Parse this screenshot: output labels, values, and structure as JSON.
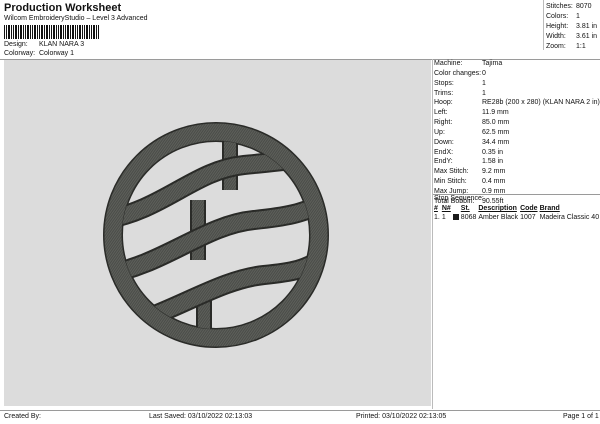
{
  "header": {
    "title": "Production Worksheet",
    "subtitle": "Wilcom EmbroideryStudio – Level 3 Advanced"
  },
  "info": {
    "design_label": "Design:",
    "design_value": "KLAN NARA 3",
    "colorway_label": "Colorway:",
    "colorway_value": "Colorway 1"
  },
  "top_stats": [
    {
      "k": "Stitches:",
      "v": "8070"
    },
    {
      "k": "Colors:",
      "v": "1"
    },
    {
      "k": "Height:",
      "v": "3.81 in"
    },
    {
      "k": "Width:",
      "v": "3.61 in"
    },
    {
      "k": "Zoom:",
      "v": "1:1"
    }
  ],
  "details": [
    {
      "k": "Machine:",
      "v": "Tajima"
    },
    {
      "k": "Color changes:",
      "v": "0"
    },
    {
      "k": "Stops:",
      "v": "1"
    },
    {
      "k": "Trims:",
      "v": "1"
    },
    {
      "k": "Hoop:",
      "v": "RE28b (200 x 280) (KLAN NARA 2 in)"
    },
    {
      "k": "Left:",
      "v": "11.9 mm"
    },
    {
      "k": "Right:",
      "v": "85.0 mm"
    },
    {
      "k": "Up:",
      "v": "62.5 mm"
    },
    {
      "k": "Down:",
      "v": "34.4 mm"
    },
    {
      "k": "EndX:",
      "v": "0.35 in"
    },
    {
      "k": "EndY:",
      "v": "1.58 in"
    },
    {
      "k": "Max Stitch:",
      "v": "9.2 mm"
    },
    {
      "k": "Min Stitch:",
      "v": "0.4 mm"
    },
    {
      "k": "Max Jump:",
      "v": "0.9 mm"
    },
    {
      "k": "Total Bobbin:",
      "v": "90.55ft"
    }
  ],
  "stop_sequence": {
    "title": "Stop Sequence:",
    "headers": [
      "#",
      "N#",
      "St.",
      "Description",
      "Code",
      "Brand"
    ],
    "rows": [
      {
        "num": "1.",
        "n": "1",
        "color": "#1a1a1a",
        "st": "8068",
        "description": "Amber Black",
        "code": "1007",
        "brand": "Madeira Classic 40"
      }
    ]
  },
  "footer": {
    "created_by": "Created By:",
    "last_saved": "Last Saved: 03/10/2022 02:13:03",
    "printed": "Printed: 03/10/2022 02:13:05",
    "page": "Page 1 of 1"
  },
  "colors": {
    "canvas_bg": "#dcdcdc",
    "thread": "#4a4c48"
  }
}
